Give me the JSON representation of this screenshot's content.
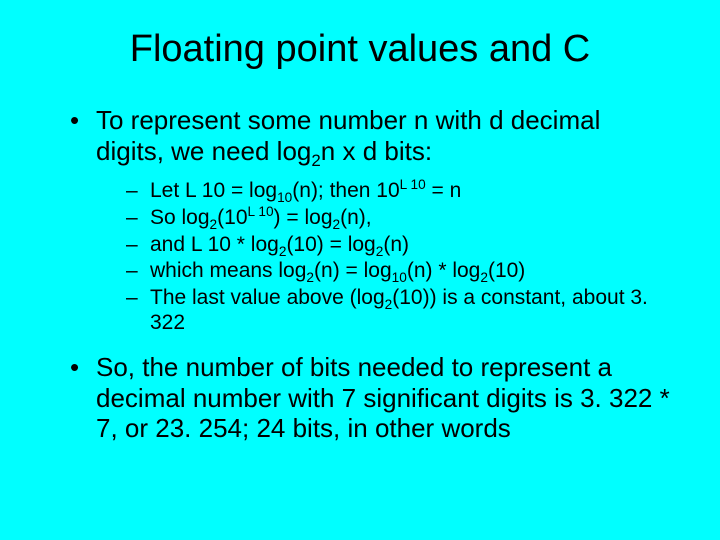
{
  "title": "Floating point values and C",
  "bullets": {
    "b1_pre": "To represent some number n with d decimal digits, we need log",
    "b1_sub": "2",
    "b1_post": "n x d bits:",
    "sub1_a": "Let L 10 = log",
    "sub1_b": "10",
    "sub1_c": "(n); then 10",
    "sub1_d": "L 10",
    "sub1_e": " = n",
    "sub2_a": "So log",
    "sub2_b": "2",
    "sub2_c": "(10",
    "sub2_d": "L 10",
    "sub2_e": ") = log",
    "sub2_f": "2",
    "sub2_g": "(n),",
    "sub3_a": "and L 10 * log",
    "sub3_b": "2",
    "sub3_c": "(10) = log",
    "sub3_d": "2",
    "sub3_e": "(n)",
    "sub4_a": "which means log",
    "sub4_b": "2",
    "sub4_c": "(n) = log",
    "sub4_d": "10",
    "sub4_e": "(n) * log",
    "sub4_f": "2",
    "sub4_g": "(10)",
    "sub5_a": "The last value above (log",
    "sub5_b": "2",
    "sub5_c": "(10)) is a constant, about 3. 322",
    "b2": "So, the number of bits needed to represent a decimal number with 7 significant digits is 3. 322 * 7, or 23. 254; 24 bits, in other words"
  }
}
